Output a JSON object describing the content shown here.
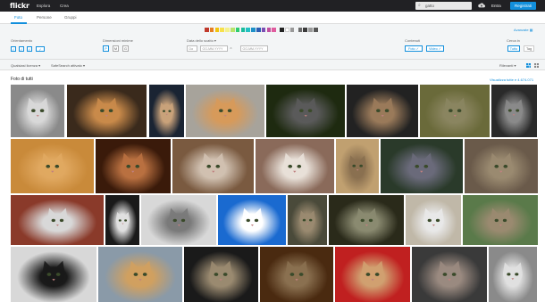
{
  "header": {
    "logo": "flickr",
    "nav": [
      "Esplora",
      "Crea"
    ],
    "search_value": "gatto",
    "login": "Entra",
    "signup": "Registrati"
  },
  "tabs": [
    "Foto",
    "Persone",
    "Gruppi"
  ],
  "filters": {
    "colors": [
      "#c0392b",
      "#e67e22",
      "#f1c40f",
      "#f7e04b",
      "#f4f18a",
      "#b9e36c",
      "#2ecc71",
      "#1abc9c",
      "#22c1c3",
      "#1e90c8",
      "#2c5fb3",
      "#7b4fb3",
      "#c04fa0",
      "#e05c9e",
      "#222222",
      "#ffffff",
      "#999999",
      "#6b6b6b",
      "#3a3a3a",
      "#9a9a9a",
      "#555555"
    ],
    "advanced_label": "Avanzate",
    "orientation_label": "Orientamento",
    "size_label": "Dimensioni minime",
    "size_options": [
      "P",
      "M",
      "G"
    ],
    "date_label": "Data dello scatto",
    "date_from_label": "Da",
    "date_from_placeholder": "GG-MM-YYYY",
    "date_to_label": "a",
    "date_to_placeholder": "GG-MM-YYYY",
    "content_label": "Contenuti",
    "content_options": [
      "Foto",
      "Video"
    ],
    "search_in_label": "Cerca in",
    "search_in_options": [
      "Tutto",
      "Tag"
    ]
  },
  "subbar": {
    "license": "Qualsiasi licenza",
    "safesearch": "SafeSearch attivato",
    "sort": "Rilevanti"
  },
  "section": {
    "title": "Foto di tutti",
    "view_all": "Visualizza tutte e 4.674.071"
  }
}
